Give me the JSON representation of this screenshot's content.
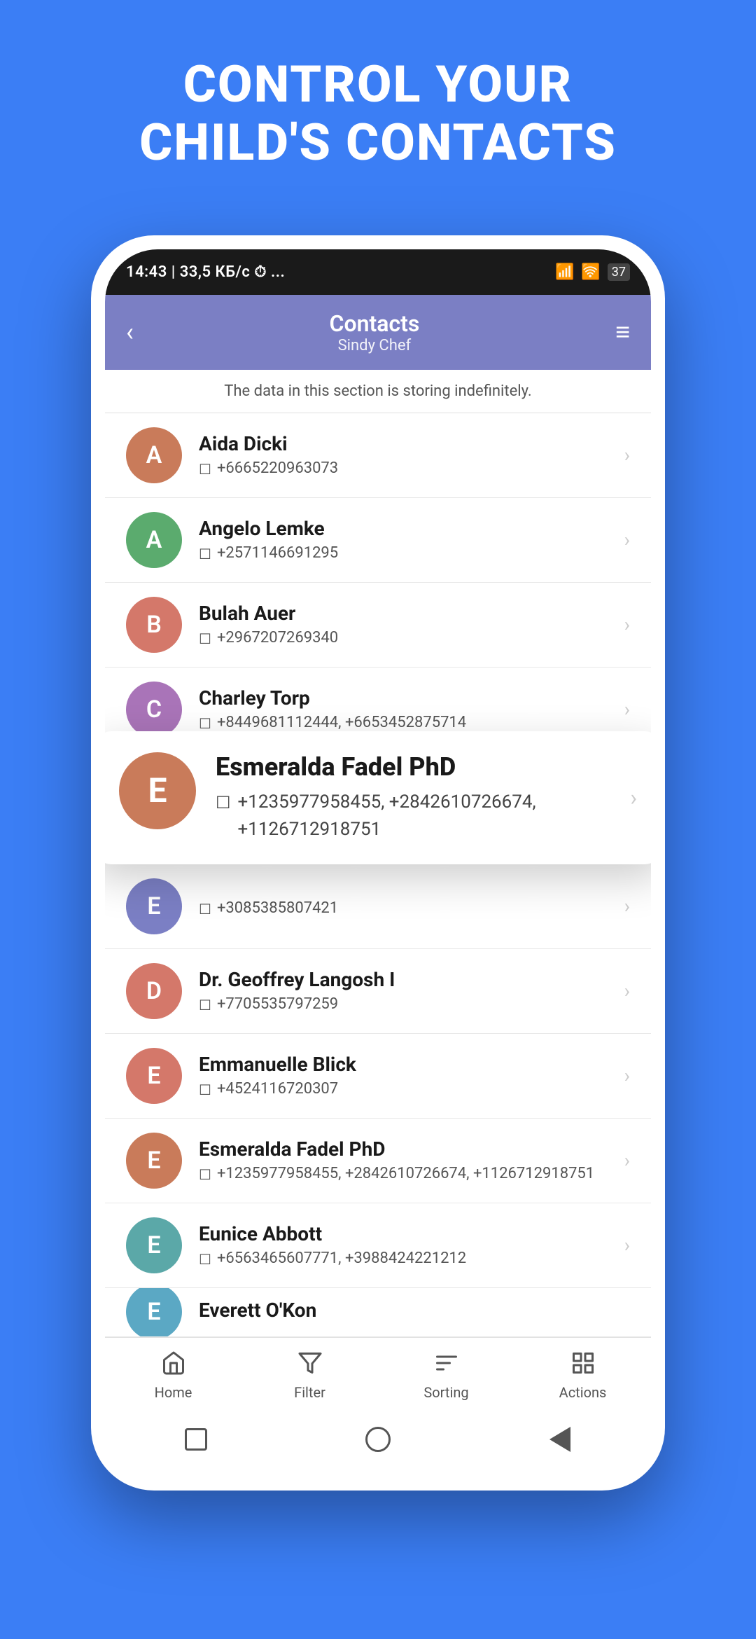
{
  "headline": {
    "line1": "CONTROL YOUR",
    "line2": "CHILD'S CONTACTS"
  },
  "statusBar": {
    "left": "14:43 | 33,5 КБ/с ⏱ ...",
    "signal": "📶",
    "wifi": "📶",
    "battery": "37"
  },
  "appHeader": {
    "title": "Contacts",
    "subtitle": "Sindy Chef",
    "backIcon": "‹",
    "menuIcon": "≡"
  },
  "infoText": "The data in this section is storing indefinitely.",
  "contacts": [
    {
      "initial": "A",
      "name": "Aida Dicki",
      "phone": "+6665220963073",
      "color": "#C97B5A"
    },
    {
      "initial": "A",
      "name": "Angelo Lemke",
      "phone": "+2571146691295",
      "color": "#5BAB6E"
    },
    {
      "initial": "B",
      "name": "Bulah Auer",
      "phone": "+2967207269340",
      "color": "#D4786A"
    },
    {
      "initial": "C",
      "name": "Charley Torp",
      "phone": "+8449681112444, +6653452875714",
      "color": "#A974B8"
    }
  ],
  "expandedContact": {
    "initial": "E",
    "name": "Esmeralda Fadel PhD",
    "phone": "+1235977958455, +2842610726674, +1126712918751",
    "color": "#C97B5A"
  },
  "contactsBelow": [
    {
      "initial": "E",
      "name": "",
      "phone": "+3085385807421",
      "color": "#7B7FC4"
    },
    {
      "initial": "D",
      "name": "Dr. Geoffrey Langosh I",
      "phone": "+7705535797259",
      "color": "#D4786A"
    },
    {
      "initial": "E",
      "name": "Emmanuelle Blick",
      "phone": "+4524116720307",
      "color": "#D4786A"
    },
    {
      "initial": "E",
      "name": "Esmeralda Fadel PhD",
      "phone": "+1235977958455, +2842610726674, +1126712918751",
      "color": "#C97B5A"
    },
    {
      "initial": "E",
      "name": "Eunice Abbott",
      "phone": "+6563465607771, +3988424221212",
      "color": "#5BA8A8"
    },
    {
      "initial": "E",
      "name": "Everett O'Kon",
      "phone": "",
      "color": "#5BA8C4",
      "partial": true
    }
  ],
  "bottomNav": [
    {
      "icon": "🏠",
      "label": "Home"
    },
    {
      "icon": "⛛",
      "label": "Filter"
    },
    {
      "icon": "≡",
      "label": "Sorting"
    },
    {
      "icon": "⊞",
      "label": "Actions"
    }
  ]
}
